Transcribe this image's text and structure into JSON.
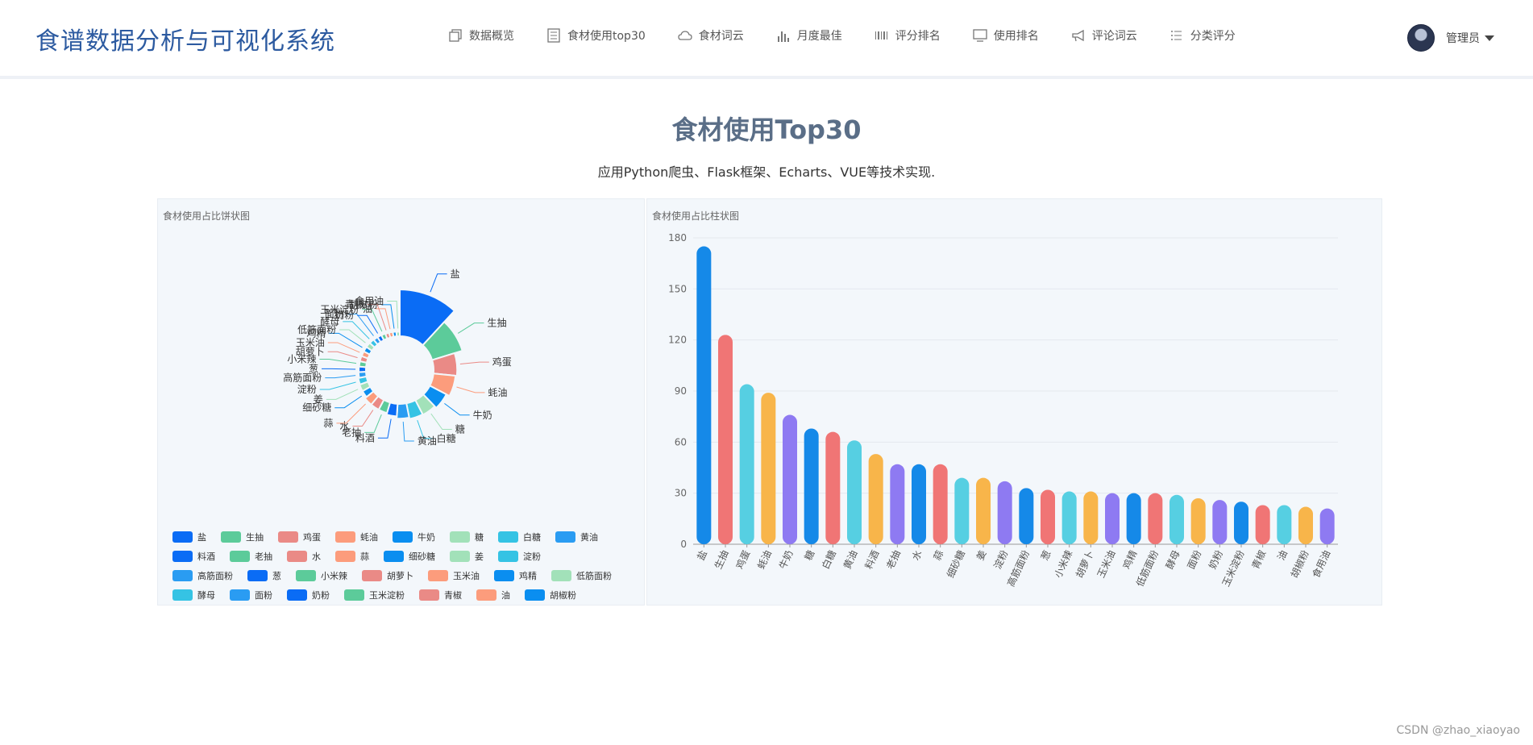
{
  "app": {
    "title": "食谱数据分析与可视化系统"
  },
  "nav": [
    {
      "label": "数据概览",
      "icon": "copy-icon"
    },
    {
      "label": "食材使用top30",
      "icon": "list-icon"
    },
    {
      "label": "食材词云",
      "icon": "cloud-icon"
    },
    {
      "label": "月度最佳",
      "icon": "bar-chart-icon"
    },
    {
      "label": "评分排名",
      "icon": "barcode-icon"
    },
    {
      "label": "使用排名",
      "icon": "monitor-icon"
    },
    {
      "label": "评论词云",
      "icon": "megaphone-icon"
    },
    {
      "label": "分类评分",
      "icon": "bullet-list-icon"
    }
  ],
  "user": {
    "name": "管理员"
  },
  "page": {
    "title": "食材使用Top30",
    "subtitle": "应用Python爬虫、Flask框架、Echarts、VUE等技术实现."
  },
  "panels": {
    "pie_title": "食材使用占比饼状图",
    "bar_title": "食材使用占比柱状图"
  },
  "footer": "CSDN @zhao_xiaoyao",
  "chart_data": [
    {
      "type": "pie",
      "title": "食材使用占比饼状图",
      "rose": true,
      "categories": [
        "盐",
        "生抽",
        "鸡蛋",
        "蚝油",
        "牛奶",
        "糖",
        "白糖",
        "黄油",
        "料酒",
        "老抽",
        "水",
        "蒜",
        "细砂糖",
        "姜",
        "淀粉",
        "高筋面粉",
        "葱",
        "小米辣",
        "胡萝卜",
        "玉米油",
        "鸡精",
        "低筋面粉",
        "酵母",
        "面粉",
        "奶粉",
        "玉米淀粉",
        "青椒",
        "油",
        "胡椒粉",
        "食用油"
      ],
      "values": [
        175,
        123,
        94,
        89,
        76,
        68,
        66,
        61,
        53,
        47,
        47,
        47,
        39,
        39,
        37,
        33,
        32,
        31,
        31,
        30,
        30,
        30,
        29,
        27,
        26,
        25,
        23,
        23,
        22,
        21
      ],
      "legend": "bottom"
    },
    {
      "type": "bar",
      "title": "食材使用占比柱状图",
      "categories": [
        "盐",
        "生抽",
        "鸡蛋",
        "蚝油",
        "牛奶",
        "糖",
        "白糖",
        "黄油",
        "料酒",
        "老抽",
        "水",
        "蒜",
        "细砂糖",
        "姜",
        "淀粉",
        "高筋面粉",
        "葱",
        "小米辣",
        "胡萝卜",
        "玉米油",
        "鸡精",
        "低筋面粉",
        "酵母",
        "面粉",
        "奶粉",
        "玉米淀粉",
        "青椒",
        "油",
        "胡椒粉",
        "食用油"
      ],
      "values": [
        175,
        123,
        94,
        89,
        76,
        68,
        66,
        61,
        53,
        47,
        47,
        47,
        39,
        39,
        37,
        33,
        32,
        31,
        31,
        30,
        30,
        30,
        29,
        27,
        26,
        25,
        23,
        23,
        22,
        21
      ],
      "yticks": [
        0,
        30,
        60,
        90,
        120,
        150,
        180
      ],
      "ylim": [
        0,
        180
      ],
      "grid": true
    }
  ],
  "colors": {
    "pie": [
      "#0a6cf5",
      "#5ccb9a",
      "#ea8a86",
      "#fc9c7c",
      "#0a8ef0",
      "#a2e1b9",
      "#35c3e4",
      "#2a9cf2"
    ],
    "bar": [
      "#1589e8",
      "#f07575",
      "#56cfe2",
      "#f8b54a",
      "#8e7af2"
    ]
  }
}
